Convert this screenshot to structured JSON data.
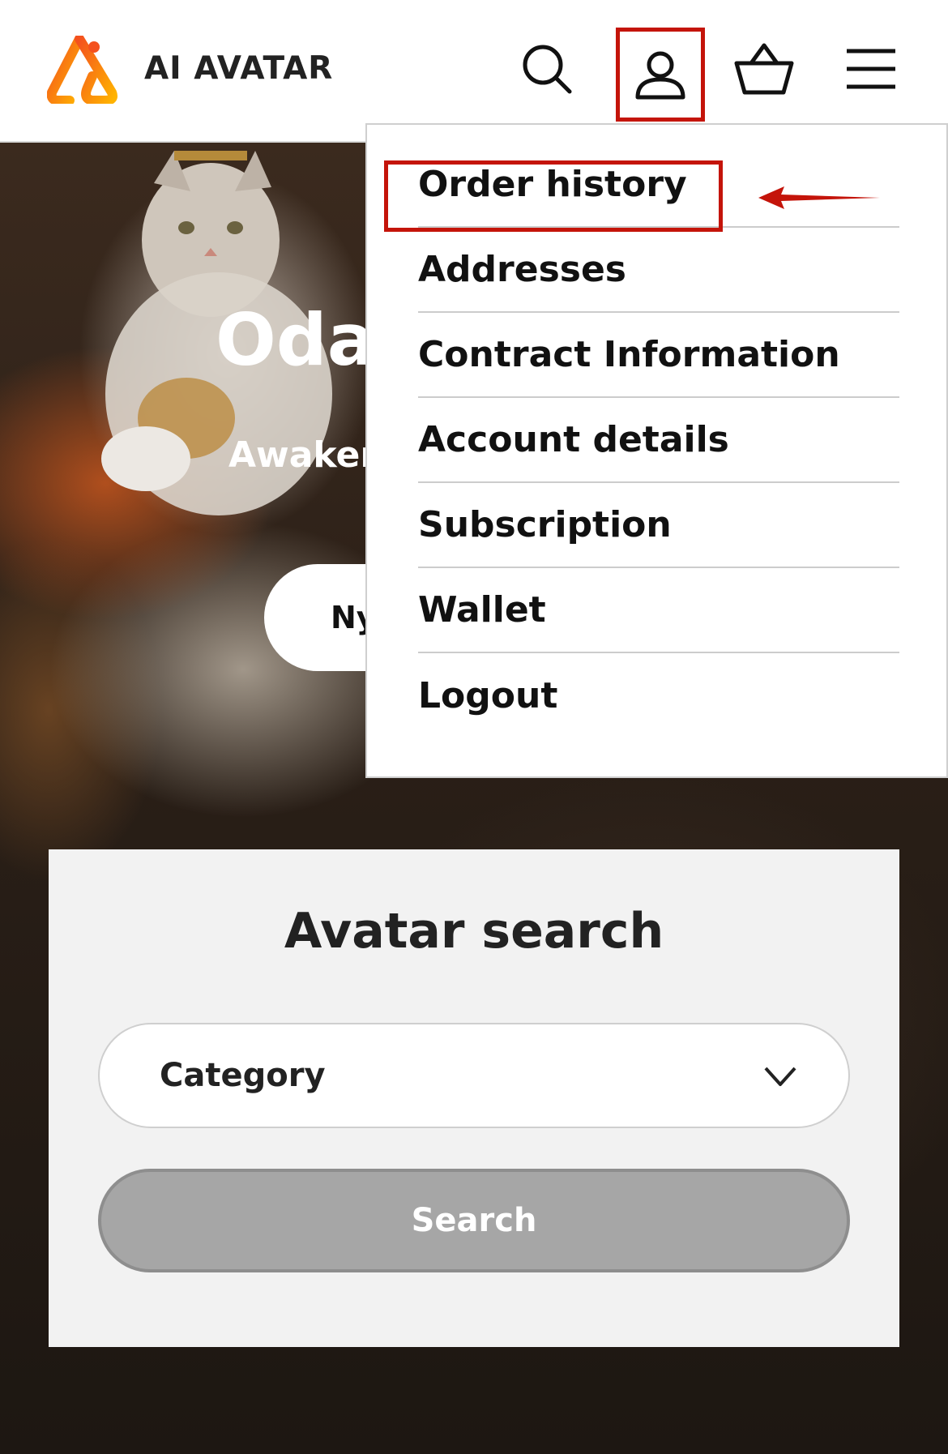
{
  "header": {
    "logo_text": "AI AVATAR",
    "icons": [
      "search-icon",
      "account-icon",
      "cart-icon",
      "menu-icon"
    ]
  },
  "hero": {
    "title": "Oda",
    "subtitle": "Awaker",
    "button_label": "Ny"
  },
  "account_menu": {
    "items": [
      {
        "label": "Order history",
        "highlighted": true
      },
      {
        "label": "Addresses"
      },
      {
        "label": "Contract Information"
      },
      {
        "label": "Account details"
      },
      {
        "label": "Subscription"
      },
      {
        "label": "Wallet"
      },
      {
        "label": "Logout"
      }
    ]
  },
  "search_card": {
    "title": "Avatar search",
    "category_value": "Category",
    "search_label": "Search"
  },
  "colors": {
    "annotation_red": "#c4140a",
    "logo_orange": "#f26a1b",
    "button_gray": "#a6a6a6"
  }
}
